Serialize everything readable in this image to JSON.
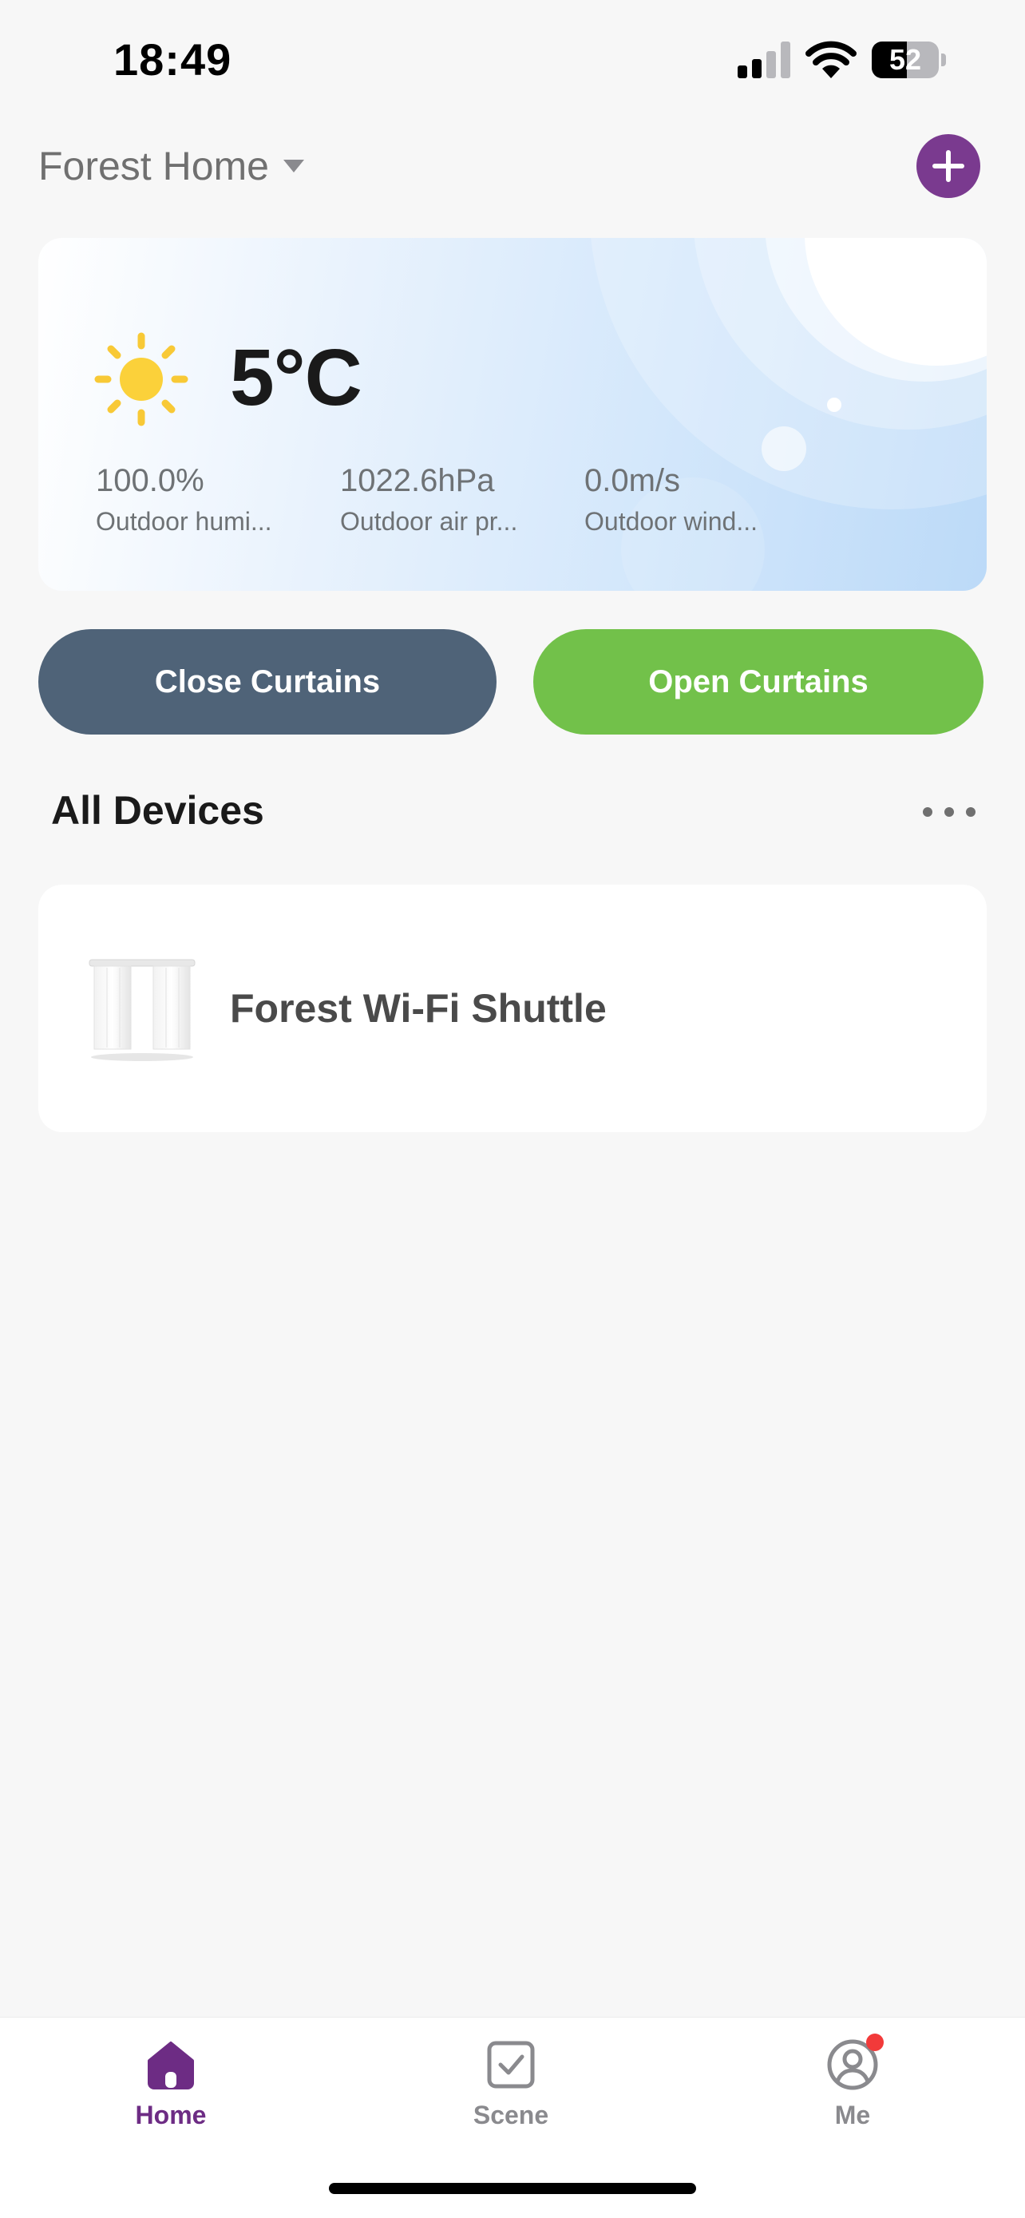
{
  "status_bar": {
    "time": "18:49",
    "battery": "52",
    "battery_level": 0.52,
    "icons": [
      "signal-icon",
      "wifi-icon",
      "battery-icon"
    ]
  },
  "header": {
    "home_name": "Forest Home",
    "icons": [
      "caret-down-icon",
      "plus-icon"
    ],
    "accent_color": "#7a3a8f"
  },
  "weather": {
    "icon": "sun-icon",
    "temperature": "5°C",
    "metrics": [
      {
        "value": "100.0%",
        "label": "Outdoor humi..."
      },
      {
        "value": "1022.6hPa",
        "label": "Outdoor air pr..."
      },
      {
        "value": "0.0m/s",
        "label": "Outdoor wind..."
      }
    ]
  },
  "actions": {
    "close_label": "Close Curtains",
    "open_label": "Open Curtains",
    "close_color": "#4f6378",
    "open_color": "#72c14a"
  },
  "devices": {
    "title": "All Devices",
    "items": [
      {
        "name": "Forest Wi-Fi Shuttle",
        "icon": "curtain-icon"
      }
    ]
  },
  "tabs": [
    {
      "label": "Home",
      "icon": "home-icon",
      "active": true
    },
    {
      "label": "Scene",
      "icon": "scene-checkbox-icon",
      "active": false
    },
    {
      "label": "Me",
      "icon": "profile-icon",
      "active": false,
      "badge": true
    }
  ]
}
